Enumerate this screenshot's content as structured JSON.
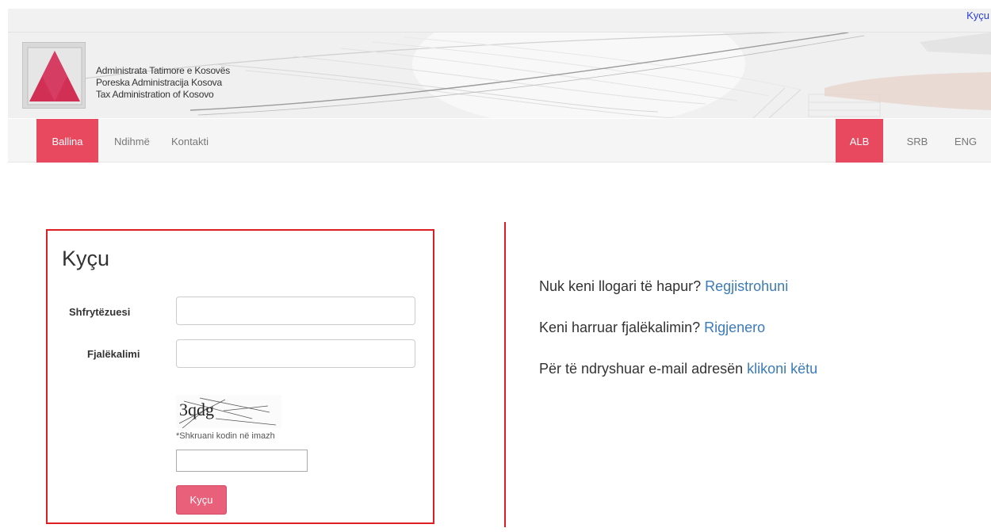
{
  "top": {
    "login_link": "Kyçu"
  },
  "header": {
    "org_names": [
      "Administrata Tatimore e Kosovës",
      "Poreska Administracija Kosova",
      "Tax Administration of Kosovo"
    ],
    "logo_icon": "triangle-logo-icon",
    "accent_color": "#e8495f"
  },
  "nav": {
    "items": [
      "Ballina",
      "Ndihmë",
      "Kontakti"
    ],
    "languages": [
      "ALB",
      "SRB",
      "ENG"
    ]
  },
  "login": {
    "title": "Kyçu",
    "username_label": "Shfrytëzuesi",
    "password_label": "Fjalëkalimi",
    "captcha_text": "3qdg",
    "captcha_note": "*Shkruani kodin në imazh",
    "submit_label": "Kyçu",
    "border_color": "#e01d25"
  },
  "info": {
    "register_text": "Nuk keni llogari të hapur?",
    "register_link": "Regjistrohuni",
    "forgot_text": "Keni harruar fjalëkalimin?",
    "forgot_link": "Rigjenero",
    "email_text": "Për të ndryshuar e-mail adresën",
    "email_link": "klikoni këtu"
  }
}
